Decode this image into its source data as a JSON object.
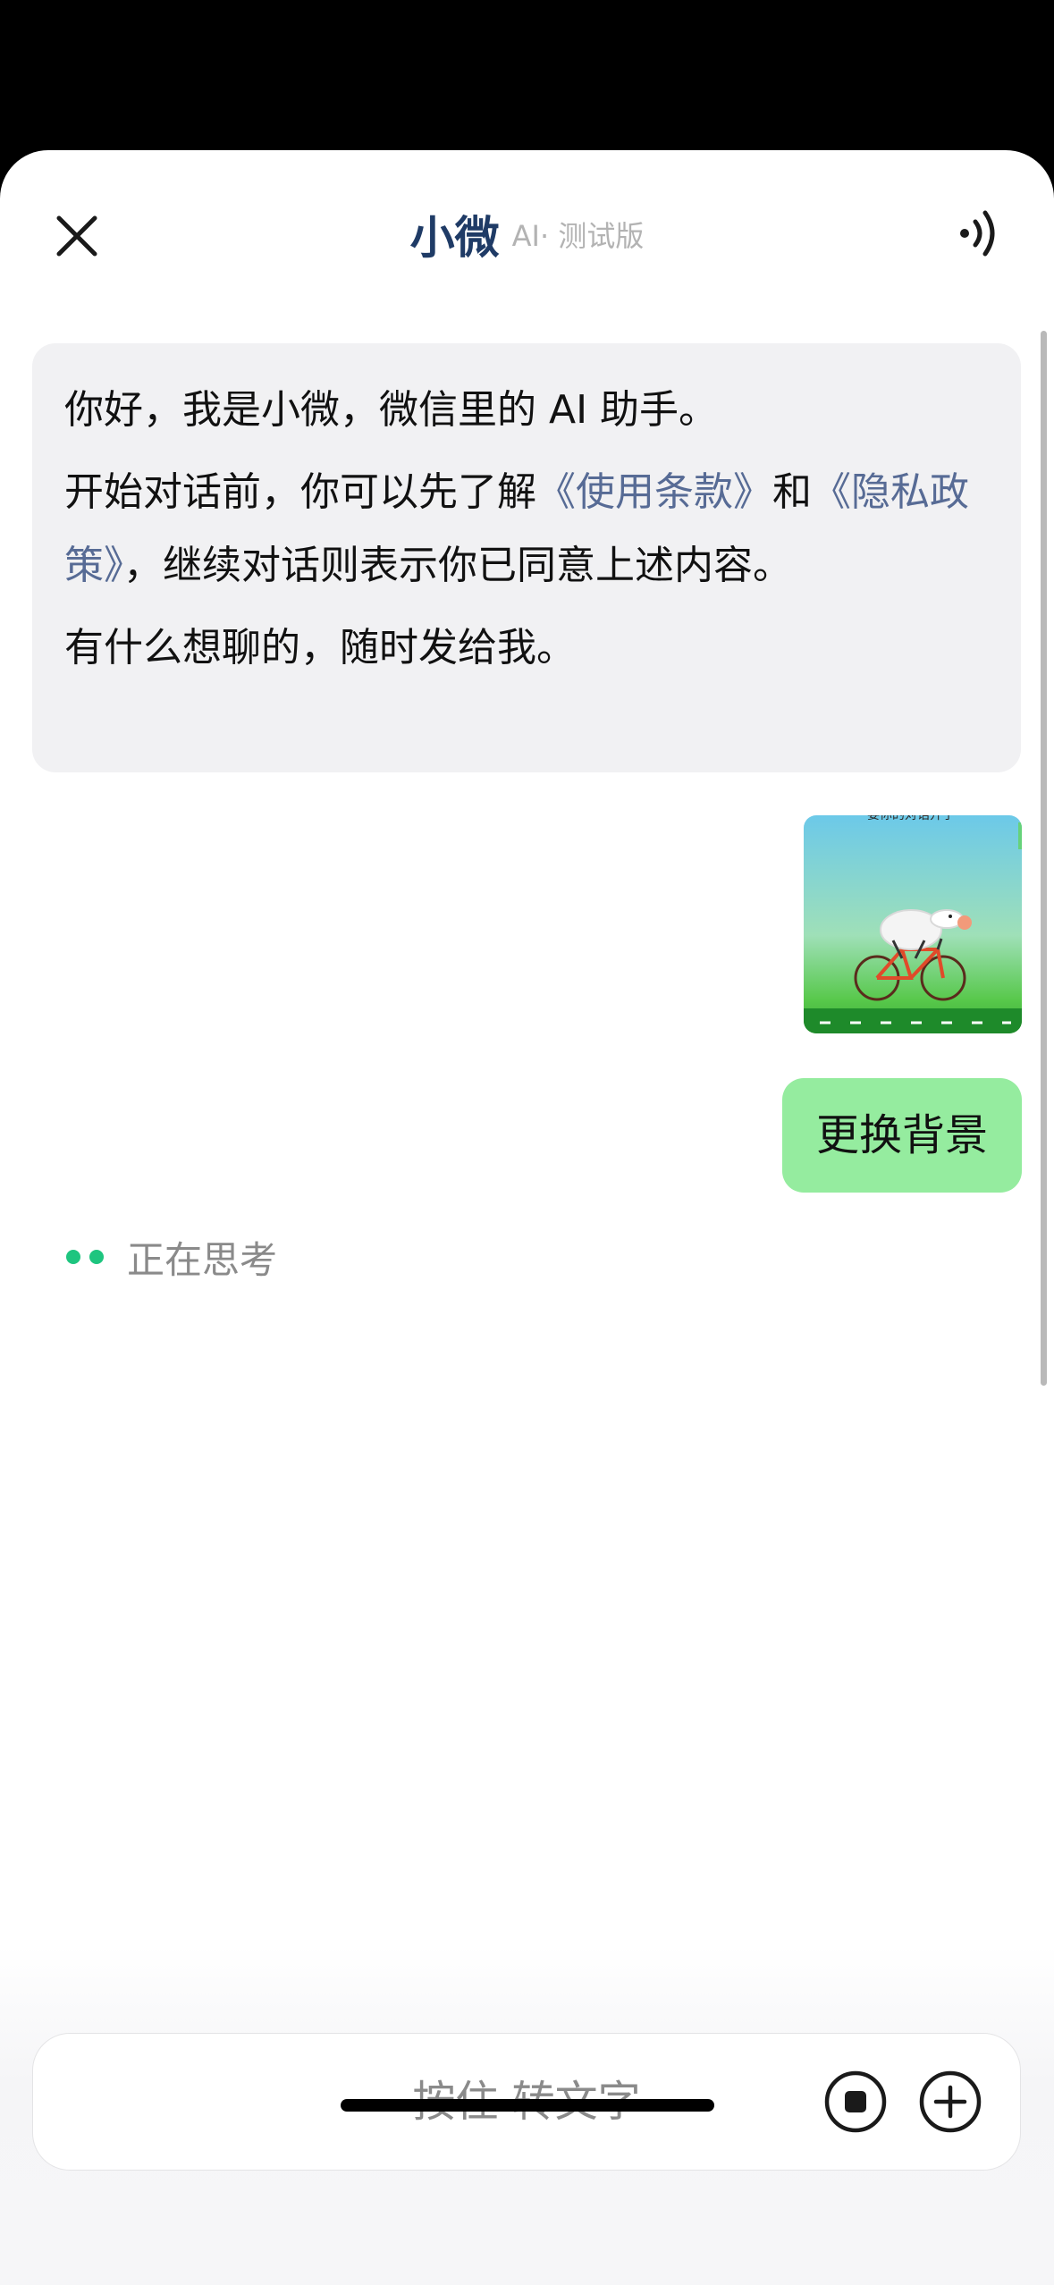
{
  "header": {
    "title": "小微",
    "subtitle": "AI· 测试版",
    "close_icon": "close-icon",
    "sound_icon": "speaker-icon"
  },
  "messages": {
    "ai_greeting": {
      "line1": "你好，我是小微，微信里的 AI 助手。",
      "line2_prefix": "开始对话前，你可以先了解",
      "terms_link": "《使用条款》",
      "line2_and": "和",
      "privacy_link": "《隐私政策》",
      "line2_suffix": "，继续对话则表示你已同意上述内容。",
      "line3": "有什么想聊的，随时发给我。"
    },
    "user_image": {
      "overlay_text": "要你的对话开了"
    },
    "user_text": "更换背景",
    "thinking_text": "正在思考"
  },
  "input": {
    "hold_to_talk": "按住 转文字",
    "stop_icon": "stop-icon",
    "add_icon": "plus-circle-icon"
  },
  "colors": {
    "accent_green": "#1ec57f",
    "user_bubble": "#95ec9f",
    "link": "#576b95",
    "title": "#1f3b66"
  }
}
